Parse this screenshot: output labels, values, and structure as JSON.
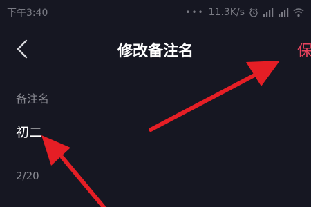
{
  "status_bar": {
    "time": "下午3:40",
    "dots": "•••",
    "network_speed": "11.3K/s",
    "icons": [
      "alarm-icon",
      "signal-icon",
      "signal-icon",
      "wifi-icon"
    ]
  },
  "nav": {
    "back_icon": "chevron-left-icon",
    "title": "修改备注名",
    "save_label": "保"
  },
  "form": {
    "field_label": "备注名",
    "value": "初二",
    "char_count": "2/20"
  },
  "colors": {
    "background": "#161722",
    "accent": "#e8435e",
    "annotation_arrow": "#e51e25",
    "muted_text": "#8a8b93"
  },
  "annotations": [
    "arrow-pointing-to-save",
    "arrow-pointing-to-name-value"
  ]
}
